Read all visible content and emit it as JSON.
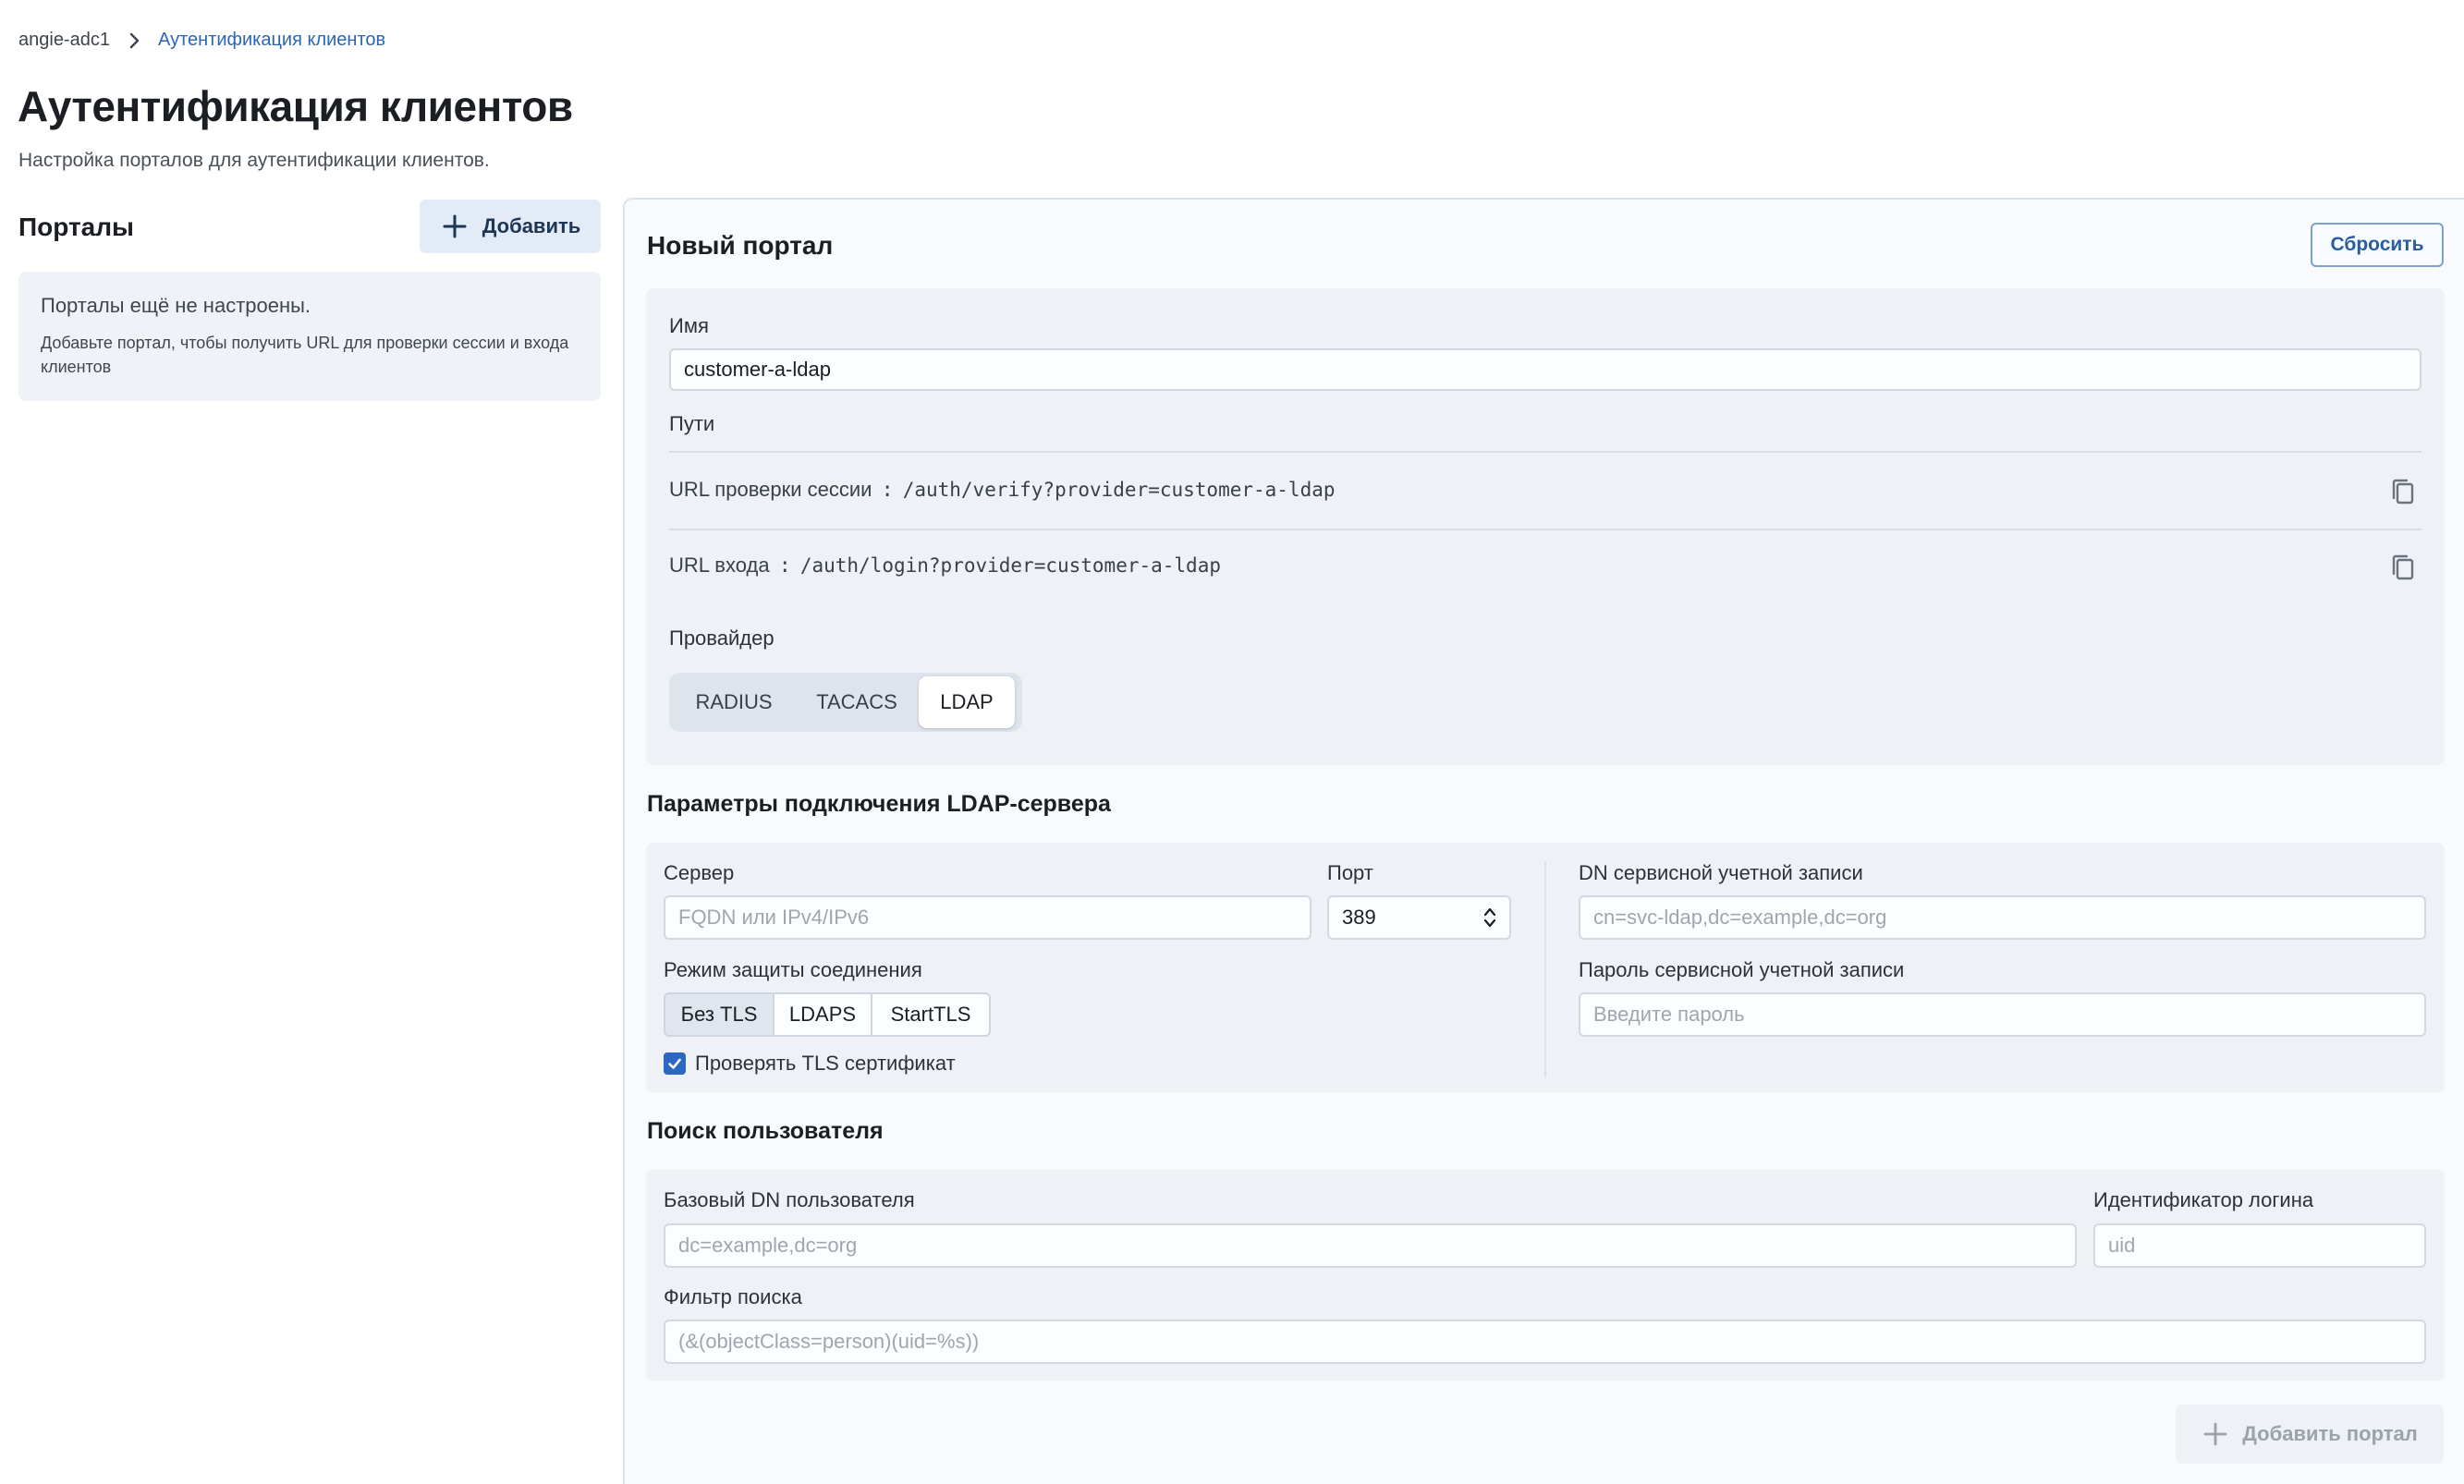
{
  "breadcrumb": {
    "root": "angie-adc1",
    "current": "Аутентификация клиентов"
  },
  "page": {
    "title": "Аутентификация клиентов",
    "subtitle": "Настройка порталов для аутентификации клиентов."
  },
  "portals": {
    "title": "Порталы",
    "add_label": "Добавить",
    "empty_title": "Порталы ещё не настроены.",
    "empty_text": "Добавьте портал, чтобы получить URL для проверки сессии и входа клиентов"
  },
  "form": {
    "title": "Новый портал",
    "reset_label": "Сбросить",
    "name_label": "Имя",
    "name_value": "customer-a-ldap",
    "paths_label": "Пути",
    "paths": [
      {
        "label": "URL проверки сессии",
        "sep": ":",
        "value": "/auth/verify?provider=customer-a-ldap"
      },
      {
        "label": "URL входа",
        "sep": ":",
        "value": "/auth/login?provider=customer-a-ldap"
      }
    ],
    "provider_label": "Провайдер",
    "providers": [
      "RADIUS",
      "TACACS",
      "LDAP"
    ],
    "provider_selected": "LDAP",
    "ldap": {
      "title": "Параметры подключения LDAP-сервера",
      "server_label": "Сервер",
      "server_placeholder": "FQDN или IPv4/IPv6",
      "port_label": "Порт",
      "port_value": "389",
      "dn_label": "DN сервисной учетной записи",
      "dn_placeholder": "cn=svc-ldap,dc=example,dc=org",
      "mode_label": "Режим защиты соединения",
      "modes": [
        "Без TLS",
        "LDAPS",
        "StartTLS"
      ],
      "mode_selected": "Без TLS",
      "password_label": "Пароль сервисной учетной записи",
      "password_placeholder": "Введите пароль",
      "verify_tls_label": "Проверять TLS сертификат",
      "verify_tls_checked": true
    },
    "search": {
      "title": "Поиск пользователя",
      "base_dn_label": "Базовый DN пользователя",
      "base_dn_placeholder": "dc=example,dc=org",
      "login_id_label": "Идентификатор логина",
      "login_id_placeholder": "uid",
      "filter_label": "Фильтр поиска",
      "filter_placeholder": "(&(objectClass=person)(uid=%s))"
    },
    "submit_label": "Добавить портал"
  },
  "colors": {
    "accent": "#2d67c4",
    "link": "#2a66b8",
    "panel_bg": "#f8fafc",
    "section_bg": "#eef2f7"
  }
}
